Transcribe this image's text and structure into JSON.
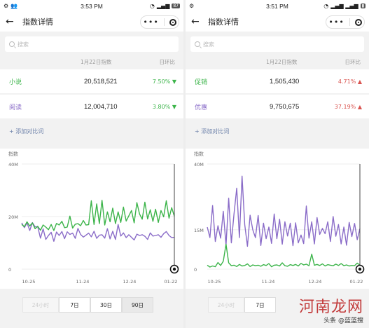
{
  "screens": [
    {
      "status": {
        "time": "3:53 PM",
        "battery": "87"
      },
      "nav": {
        "title": "指数详情",
        "back_icon": "←"
      },
      "search": {
        "placeholder": "搜索"
      },
      "table": {
        "date_header": "1月22日指数",
        "change_header": "日环比",
        "rows": [
          {
            "name": "小说",
            "value": "20,518,521",
            "change": "7.50%",
            "direction": "down",
            "name_color": "#3cb44a",
            "change_color": "#3cb44a"
          },
          {
            "name": "阅读",
            "value": "12,004,710",
            "change": "3.80%",
            "direction": "down",
            "name_color": "#8a6cc8",
            "change_color": "#3cb44a"
          }
        ]
      },
      "add_compare": "+ 添加对比词",
      "chart_data": {
        "type": "line",
        "ylabel": "指数",
        "yticks": [
          "40M",
          "20M",
          "0"
        ],
        "ylim": [
          0,
          40000000
        ],
        "xticks": [
          "10-25",
          "11-24",
          "12-24",
          "01-22"
        ],
        "series": [
          {
            "name": "小说",
            "color": "#3cb44a",
            "values": [
              17000000,
              16200000,
              18000000,
              16400000,
              17600000,
              15400000,
              16300000,
              14800000,
              16800000,
              16000000,
              15000000,
              17000000,
              14700000,
              17400000,
              16800000,
              18200000,
              15800000,
              16000000,
              20200000,
              15600000,
              17100000,
              17300000,
              16500000,
              18500000,
              16800000,
              16900000,
              26000000,
              17000000,
              24800000,
              17300000,
              26200000,
              16800000,
              21800000,
              18000000,
              23200000,
              17300000,
              21800000,
              17800000,
              23600000,
              18300000,
              20300000,
              22300000,
              17600000,
              25300000,
              21000000,
              19000000,
              25500000,
              19100000,
              22600000,
              18200000,
              22800000,
              17800000,
              22300000,
              19900000,
              26000000,
              19400000,
              23400000,
              20100000
            ]
          },
          {
            "name": "阅读",
            "color": "#8a6cc8",
            "values": [
              17600000,
              15800000,
              17600000,
              14700000,
              17700000,
              16100000,
              16100000,
              11800000,
              15300000,
              11300000,
              12800000,
              14000000,
              10600000,
              14100000,
              12800000,
              14300000,
              11600000,
              14200000,
              13200000,
              13700000,
              11700000,
              15500000,
              13200000,
              12200000,
              12900000,
              13700000,
              12300000,
              14400000,
              11700000,
              12900000,
              13100000,
              11800000,
              15400000,
              11500000,
              14400000,
              11300000,
              17000000,
              12600000,
              13800000,
              12000000,
              13100000,
              12100000,
              11100000,
              13300000,
              12800000,
              13100000,
              12500000,
              11300000,
              13800000,
              12600000,
              12800000,
              13100000,
              12100000,
              13500000,
              14300000,
              12800000,
              12000000,
              12100000
            ]
          }
        ]
      },
      "range_buttons": [
        {
          "label": "24小时",
          "state": "disabled"
        },
        {
          "label": "7日",
          "state": "normal"
        },
        {
          "label": "30日",
          "state": "normal"
        },
        {
          "label": "90日",
          "state": "active"
        }
      ]
    },
    {
      "status": {
        "time": "3:51 PM",
        "battery": ""
      },
      "nav": {
        "title": "指数详情",
        "back_icon": "←"
      },
      "search": {
        "placeholder": "搜索"
      },
      "table": {
        "date_header": "1月22日指数",
        "change_header": "日环比",
        "rows": [
          {
            "name": "促销",
            "value": "1,505,430",
            "change": "4.71%",
            "direction": "up",
            "name_color": "#3cb44a",
            "change_color": "#d9534f"
          },
          {
            "name": "优惠",
            "value": "9,750,675",
            "change": "37.19%",
            "direction": "up",
            "name_color": "#8a6cc8",
            "change_color": "#d9534f"
          }
        ]
      },
      "add_compare": "+ 添加对比词",
      "chart_data": {
        "type": "line",
        "ylabel": "指数",
        "yticks": [
          "40M",
          "15M",
          "0"
        ],
        "ylim": [
          0,
          40000000
        ],
        "xticks": [
          "10-25",
          "11-24",
          "12-24",
          "01-22"
        ],
        "series": [
          {
            "name": "促销",
            "color": "#3cb44a",
            "values": [
              1500000,
              800000,
              1200000,
              900000,
              2500000,
              1400000,
              3000000,
              9500000,
              2400000,
              1300000,
              1500000,
              1000000,
              1800000,
              1200000,
              1400000,
              2000000,
              1000000,
              1600000,
              1300000,
              1500000,
              1100000,
              1700000,
              1400000,
              2100000,
              900000,
              1500000,
              1600000,
              1200000,
              2400000,
              1300000,
              1100000,
              1700000,
              1400000,
              1800000,
              1200000,
              2200000,
              1600000,
              1900000,
              1300000,
              5700000,
              1500000,
              1800000,
              1400000,
              2000000,
              1200000,
              1700000,
              1500000,
              1300000,
              1900000,
              1400000,
              2100000,
              1300000,
              1600000,
              1200000,
              1400000,
              1300000,
              2300000,
              1500000
            ]
          },
          {
            "name": "优惠",
            "color": "#8a6cc8",
            "values": [
              16000000,
              12000000,
              24200000,
              10500000,
              16500000,
              11800000,
              22000000,
              9000000,
              27000000,
              10000000,
              21000000,
              30800000,
              12000000,
              35400000,
              17000000,
              8700000,
              20500000,
              15000000,
              12000000,
              20400000,
              9000000,
              17500000,
              11600000,
              16000000,
              9800000,
              21000000,
              11600000,
              19000000,
              9500000,
              18000000,
              12600000,
              17500000,
              8900000,
              17600000,
              10000000,
              13000000,
              9700000,
              24000000,
              11800000,
              18000000,
              9600000,
              19600000,
              13200000,
              15500000,
              13500000,
              18000000,
              10500000,
              20000000,
              12500000,
              17000000,
              9600000,
              16000000,
              9100000,
              17800000,
              12400000,
              17400000,
              11200000,
              15400000
            ]
          }
        ]
      },
      "range_buttons": [
        {
          "label": "24小时",
          "state": "disabled"
        },
        {
          "label": "7日",
          "state": "normal"
        }
      ],
      "watermark": {
        "text": "河南龙网",
        "caption": "头条 @蓝蓝搜"
      }
    }
  ]
}
